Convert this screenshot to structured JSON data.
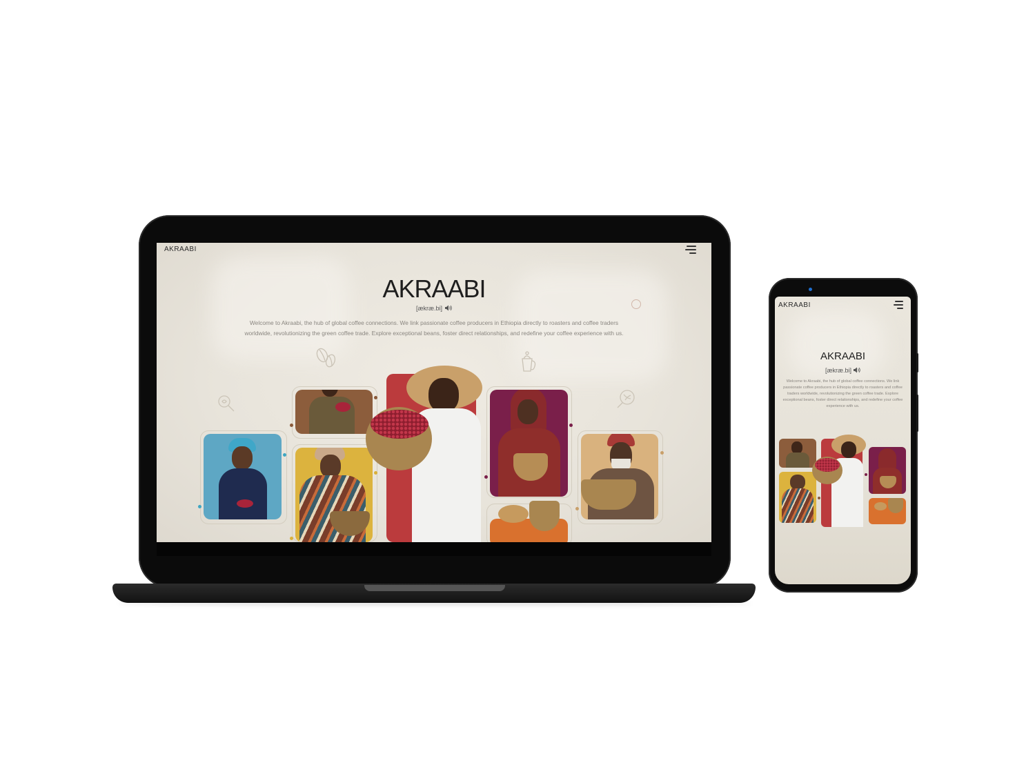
{
  "laptop": {
    "brand": "AKRAABI",
    "hero": {
      "title": "AKRAABI",
      "phonetic": "[ækræ.bi]",
      "intro": "Welcome to Akraabi, the hub of global coffee connections. We link passionate coffee producers in Ethiopia directly to roasters and coffee traders worldwide, revolutionizing the green coffee trade. Explore exceptional beans, foster direct relationships, and redefine your coffee experience with us."
    }
  },
  "phone": {
    "brand": "AKRAABI",
    "hero": {
      "title": "AKRAABI",
      "phonetic": "[ækræ.bi]",
      "intro": "Welcome to Akraabi, the hub of global coffee connections. We link passionate coffee producers in Ethiopia directly to roasters and coffee traders worldwide, revolutionizing the green coffee trade. Explore exceptional beans, foster direct relationships, and redefine your coffee experience with us."
    }
  },
  "colors": {
    "page_bg": "#e9e5dc",
    "card_blue": "#62a9c6",
    "card_brown": "#8a5a3a",
    "card_yellow": "#d9b03a",
    "card_red": "#b83a3c",
    "card_plum": "#7c1f4a",
    "card_sand": "#d8b07a",
    "card_orange": "#d9712e",
    "coffee_cherry": "#a8243a"
  },
  "icons": [
    "menu-icon",
    "speaker-icon",
    "coffee-bean-icon",
    "magnifier-icon",
    "coffee-pot-icon",
    "leaf-icon"
  ]
}
